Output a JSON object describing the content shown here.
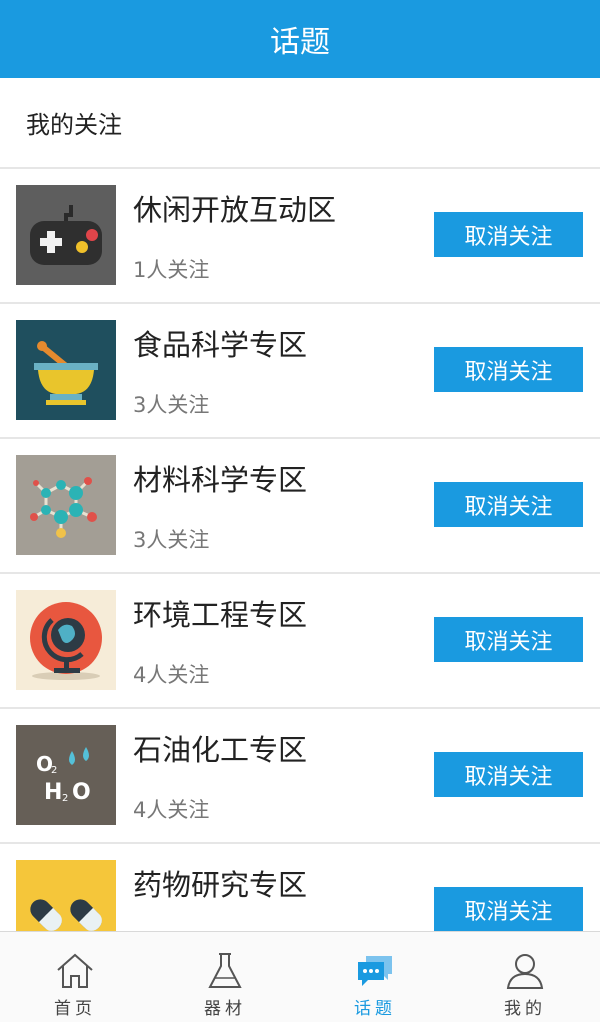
{
  "header": {
    "title": "话题"
  },
  "section": {
    "title": "我的关注"
  },
  "topics": [
    {
      "name": "休闲开放互动区",
      "followers": "1人关注",
      "button": "取消关注",
      "icon": "gamepad-icon"
    },
    {
      "name": "食品科学专区",
      "followers": "3人关注",
      "button": "取消关注",
      "icon": "mortar-pestle-icon"
    },
    {
      "name": "材料科学专区",
      "followers": "3人关注",
      "button": "取消关注",
      "icon": "molecule-icon"
    },
    {
      "name": "环境工程专区",
      "followers": "4人关注",
      "button": "取消关注",
      "icon": "globe-icon"
    },
    {
      "name": "石油化工专区",
      "followers": "4人关注",
      "button": "取消关注",
      "icon": "h2o-formula-icon"
    },
    {
      "name": "药物研究专区",
      "followers": "",
      "button": "取消关注",
      "icon": "pills-icon"
    }
  ],
  "tabbar": {
    "items": [
      {
        "label": "首页",
        "icon": "home-icon"
      },
      {
        "label": "器材",
        "icon": "flask-icon"
      },
      {
        "label": "话题",
        "icon": "chat-bubbles-icon",
        "active": true
      },
      {
        "label": "我的",
        "icon": "user-icon"
      }
    ]
  },
  "colors": {
    "accent": "#1a9ae0",
    "divider": "#e6e6e6"
  }
}
